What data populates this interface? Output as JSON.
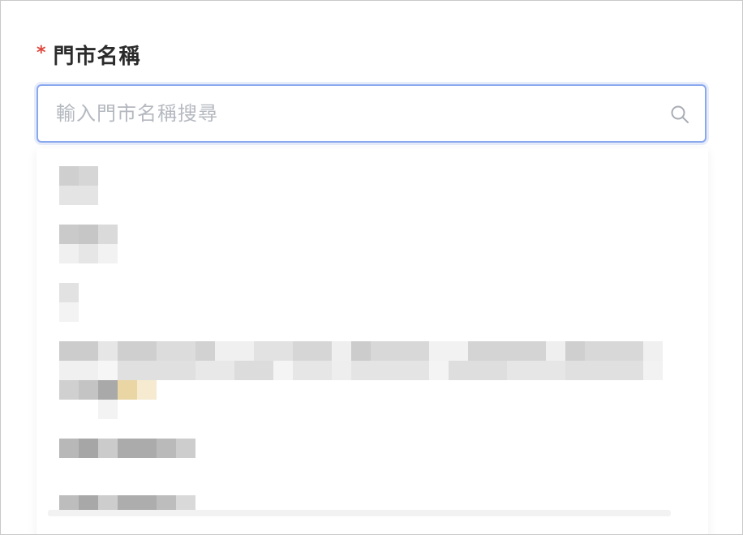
{
  "form": {
    "required_mark": "*",
    "label": "門市名稱",
    "search_placeholder": "輸入門市名稱搜尋",
    "search_value": ""
  },
  "icons": {
    "search": "search-icon"
  },
  "colors": {
    "label": "#2b2b2b",
    "required": "#e0463c",
    "focus_border": "#8aa8ee",
    "placeholder": "#b4b8bf"
  },
  "dropdown": {
    "note": "",
    "options": [
      {
        "id": "option-1"
      },
      {
        "id": "option-2"
      },
      {
        "id": "option-3"
      },
      {
        "id": "option-4"
      },
      {
        "id": "option-5"
      },
      {
        "id": "option-6"
      }
    ]
  }
}
